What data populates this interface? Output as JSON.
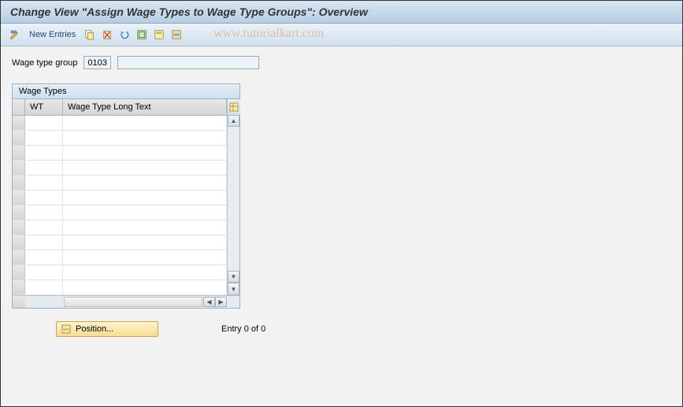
{
  "title": "Change View \"Assign Wage Types to Wage Type Groups\": Overview",
  "toolbar": {
    "new_entries_label": "New Entries"
  },
  "watermark": "www.tutorialkart.com",
  "filter": {
    "label": "Wage type group",
    "value": "0103"
  },
  "table": {
    "caption": "Wage Types",
    "columns": {
      "wt": "WT",
      "long_text": "Wage Type Long Text"
    },
    "rows": []
  },
  "position_button_label": "Position...",
  "entry_status": "Entry 0 of 0"
}
